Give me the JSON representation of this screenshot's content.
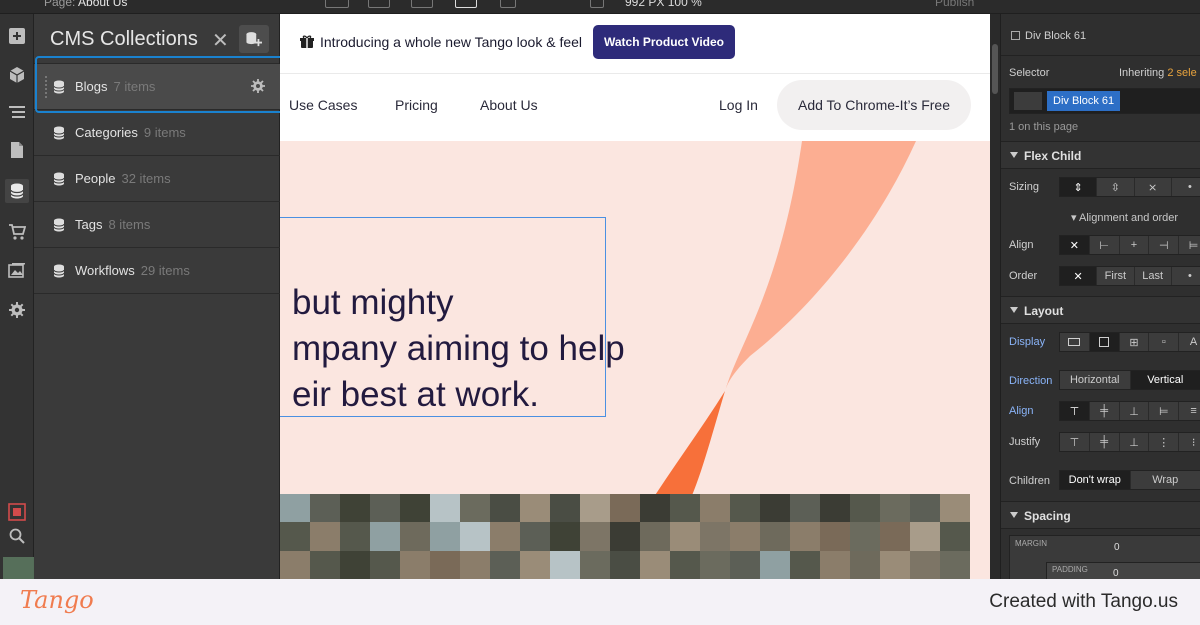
{
  "topbar": {
    "page_prefix": "Page:",
    "page_name": "About Us",
    "breakpoint": "992 PX",
    "zoom": "100 %",
    "publish": "Publish"
  },
  "cms": {
    "title": "CMS Collections",
    "collections": [
      {
        "name": "Blogs",
        "count": "7 items"
      },
      {
        "name": "Categories",
        "count": "9 items"
      },
      {
        "name": "People",
        "count": "32 items"
      },
      {
        "name": "Tags",
        "count": "8 items"
      },
      {
        "name": "Workflows",
        "count": "29 items"
      }
    ]
  },
  "site": {
    "announcement": "Introducing a whole new Tango look & feel",
    "video_button": "Watch Product Video",
    "nav": {
      "use_cases": "Use Cases",
      "pricing": "Pricing",
      "about": "About Us",
      "login": "Log In",
      "cta": "Add To Chrome-It’s Free"
    },
    "headline": [
      " but mighty",
      "mpany aiming to help",
      "eir best at work."
    ]
  },
  "style_panel": {
    "element": "Div Block 61",
    "selector_label": "Selector",
    "inheriting": "Inheriting",
    "inheriting_count": "2 sele",
    "selector_chip": "Div Block 61",
    "on_page": "1 on this page",
    "flex_child": "Flex Child",
    "sizing": "Sizing",
    "alignment_order": "Alignment and order",
    "align": "Align",
    "order": "Order",
    "order_first": "First",
    "order_last": "Last",
    "layout": "Layout",
    "display": "Display",
    "direction": "Direction",
    "horizontal": "Horizontal",
    "vertical": "Vertical",
    "align2": "Align",
    "justify": "Justify",
    "children": "Children",
    "dont_wrap": "Don't wrap",
    "wrap": "Wrap",
    "spacing": "Spacing",
    "margin": "MARGIN",
    "margin_val": "0",
    "padding": "PADDING",
    "padding_val": "0"
  },
  "footer": {
    "logo": "Tango",
    "made_with": "Created with Tango.us"
  },
  "colors": {
    "accent": "#1a82cf",
    "video_btn": "#2e2b7a",
    "hero_bg": "#fbe6e0",
    "ribbon_light": "#fcae92",
    "ribbon_dark": "#f7703a"
  }
}
